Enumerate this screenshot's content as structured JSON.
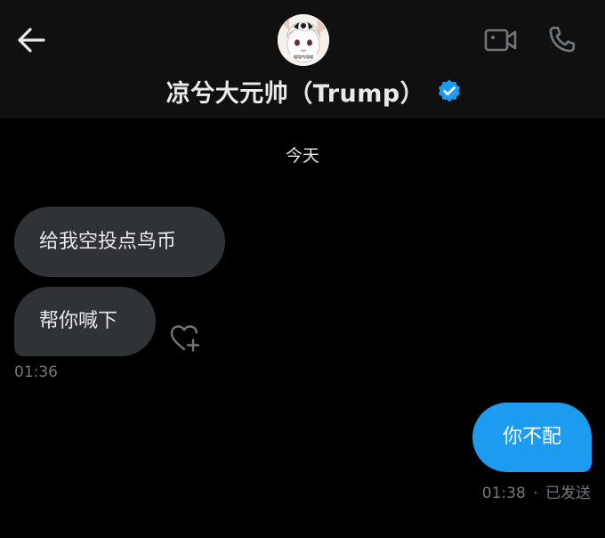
{
  "header": {
    "contact_name": "凉兮大元帅（Trump）",
    "avatar_caption": "喵喵呜喵喵",
    "icons": {
      "back": "arrow-left-icon",
      "verified": "verified-badge-icon",
      "video": "video-camera-icon",
      "call": "phone-icon"
    }
  },
  "chat": {
    "date_divider": "今天",
    "messages": [
      {
        "direction": "incoming",
        "text": "给我空投点鸟币"
      },
      {
        "direction": "incoming",
        "text": "帮你喊下"
      },
      {
        "direction": "outgoing",
        "text": "你不配"
      }
    ],
    "incoming_timestamp": "01:36",
    "outgoing_timestamp": "01:38",
    "outgoing_separator": "·",
    "outgoing_status": "已发送",
    "reaction_icon": "heart-plus-icon"
  },
  "colors": {
    "background": "#000000",
    "header_background": "#101010",
    "incoming_bubble": "#2f3336",
    "outgoing_bubble": "#1d9bf0",
    "verified_blue": "#1d9bf0",
    "muted_text": "#71767b",
    "primary_text": "#e7e9ea"
  }
}
